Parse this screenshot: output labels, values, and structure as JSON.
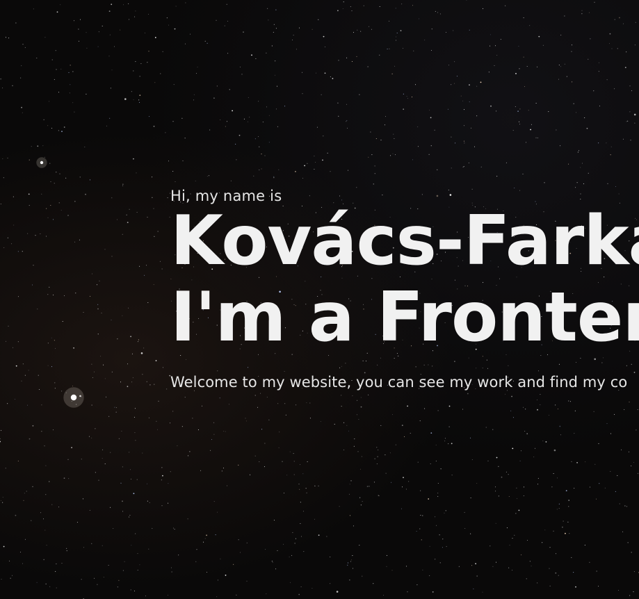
{
  "hero": {
    "greeting": "Hi, my name is",
    "name": "Kovács-Farka",
    "role": "I'm a Fronten",
    "welcome": "Welcome to my website, you can see my work and find my co"
  },
  "colors": {
    "background": "#0a0909",
    "text": "#f1f1f1"
  }
}
